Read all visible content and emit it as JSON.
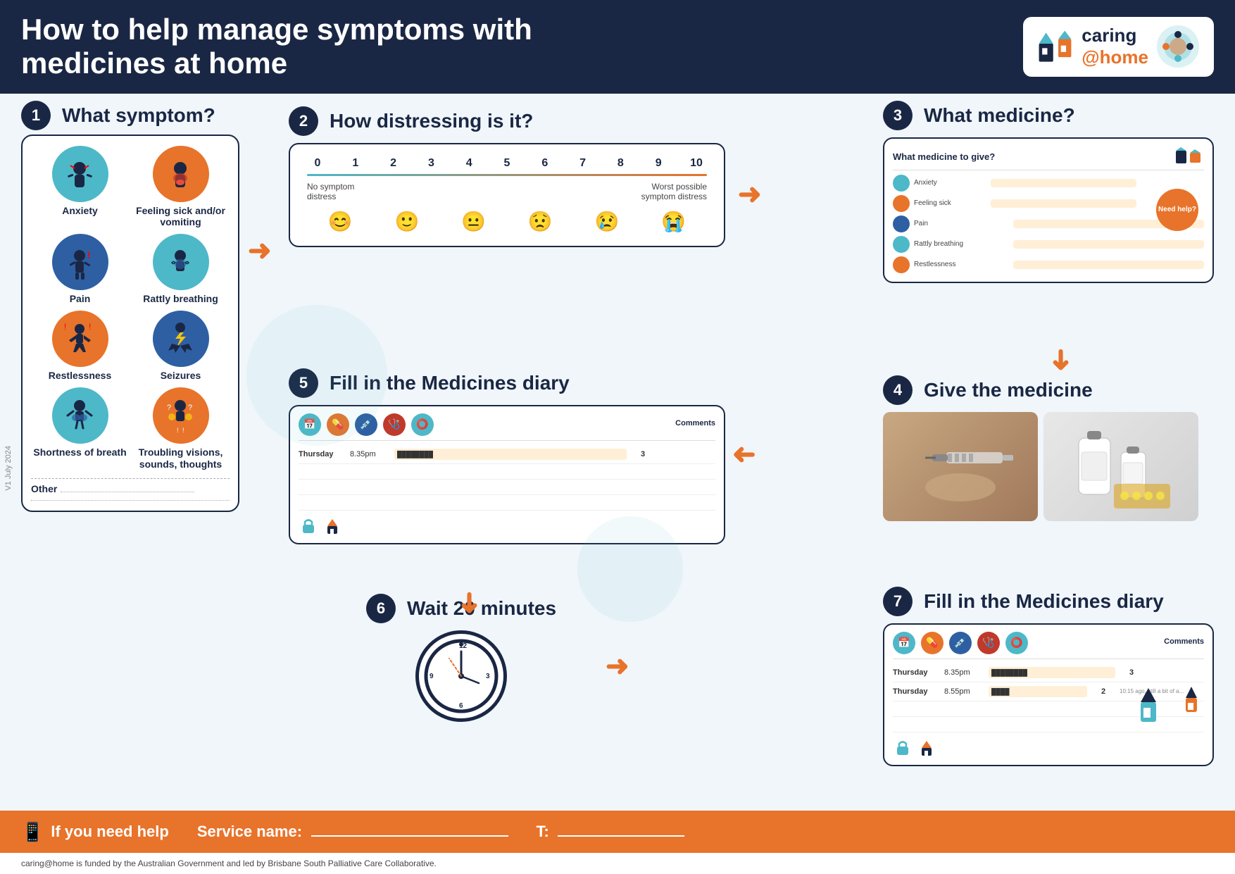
{
  "header": {
    "title": "How to help manage symptoms with medicines at home",
    "logo_text1": "caring",
    "logo_text2": "@home",
    "funded_by": "caring@home is funded by the Australian Government and led by Brisbane South Palliative Care Collaborative."
  },
  "step1": {
    "number": "1",
    "title": "What symptom?",
    "symptoms": [
      {
        "label": "Anxiety",
        "icon": "😰",
        "color": "#4db8c8"
      },
      {
        "label": "Feeling sick and/or vomiting",
        "icon": "🤢",
        "color": "#e8732a"
      },
      {
        "label": "Pain",
        "icon": "🤕",
        "color": "#2e5fa3"
      },
      {
        "label": "Rattly breathing",
        "icon": "😮‍💨",
        "color": "#4db8c8"
      },
      {
        "label": "Restlessness",
        "icon": "😣",
        "color": "#e8732a"
      },
      {
        "label": "Seizures",
        "icon": "⚡",
        "color": "#2e5fa3"
      },
      {
        "label": "Shortness of breath",
        "icon": "😤",
        "color": "#4db8c8"
      },
      {
        "label": "Troubling visions, sounds, thoughts",
        "icon": "😵",
        "color": "#e8732a"
      }
    ],
    "other_label": "Other"
  },
  "step2": {
    "number": "2",
    "title": "How distressing is it?",
    "scale_start": "0",
    "scale_end": "10",
    "numbers": [
      "0",
      "1",
      "2",
      "3",
      "4",
      "5",
      "6",
      "7",
      "8",
      "9",
      "10"
    ],
    "label_left": "No symptom distress",
    "label_right": "Worst possible symptom distress",
    "faces": [
      "😊",
      "🙂",
      "😐",
      "😟",
      "😢",
      "😭"
    ]
  },
  "step3": {
    "number": "3",
    "title": "What medicine?",
    "card_title": "What medicine to give?",
    "need_help": "Need help?",
    "rows": [
      {
        "label": "Anxiety",
        "detail": ""
      },
      {
        "label": "Feeling sick and/or vomiting",
        "detail": ""
      },
      {
        "label": "Pain",
        "detail": ""
      },
      {
        "label": "Rattly breathing",
        "detail": ""
      },
      {
        "label": "Restlessness",
        "detail": ""
      }
    ]
  },
  "step4": {
    "number": "4",
    "title": "Give the medicine"
  },
  "step5": {
    "number": "5",
    "title": "Fill in the Medicines diary",
    "diary_row": {
      "day": "Thursday",
      "time": "8.35pm",
      "number": "3",
      "comments": ""
    }
  },
  "step6": {
    "number": "6",
    "title": "Wait 20 minutes"
  },
  "step7": {
    "number": "7",
    "title": "Fill in the Medicines diary",
    "diary_row": {
      "day": "Thursday",
      "time": "8.55pm",
      "number": "2",
      "comments": "10:15 ago, still a bit of a..."
    }
  },
  "footer": {
    "help_label": "If you need help",
    "service_label": "Service name:",
    "t_label": "T:",
    "phone_icon": "📱"
  },
  "version": "V1 July 2024"
}
